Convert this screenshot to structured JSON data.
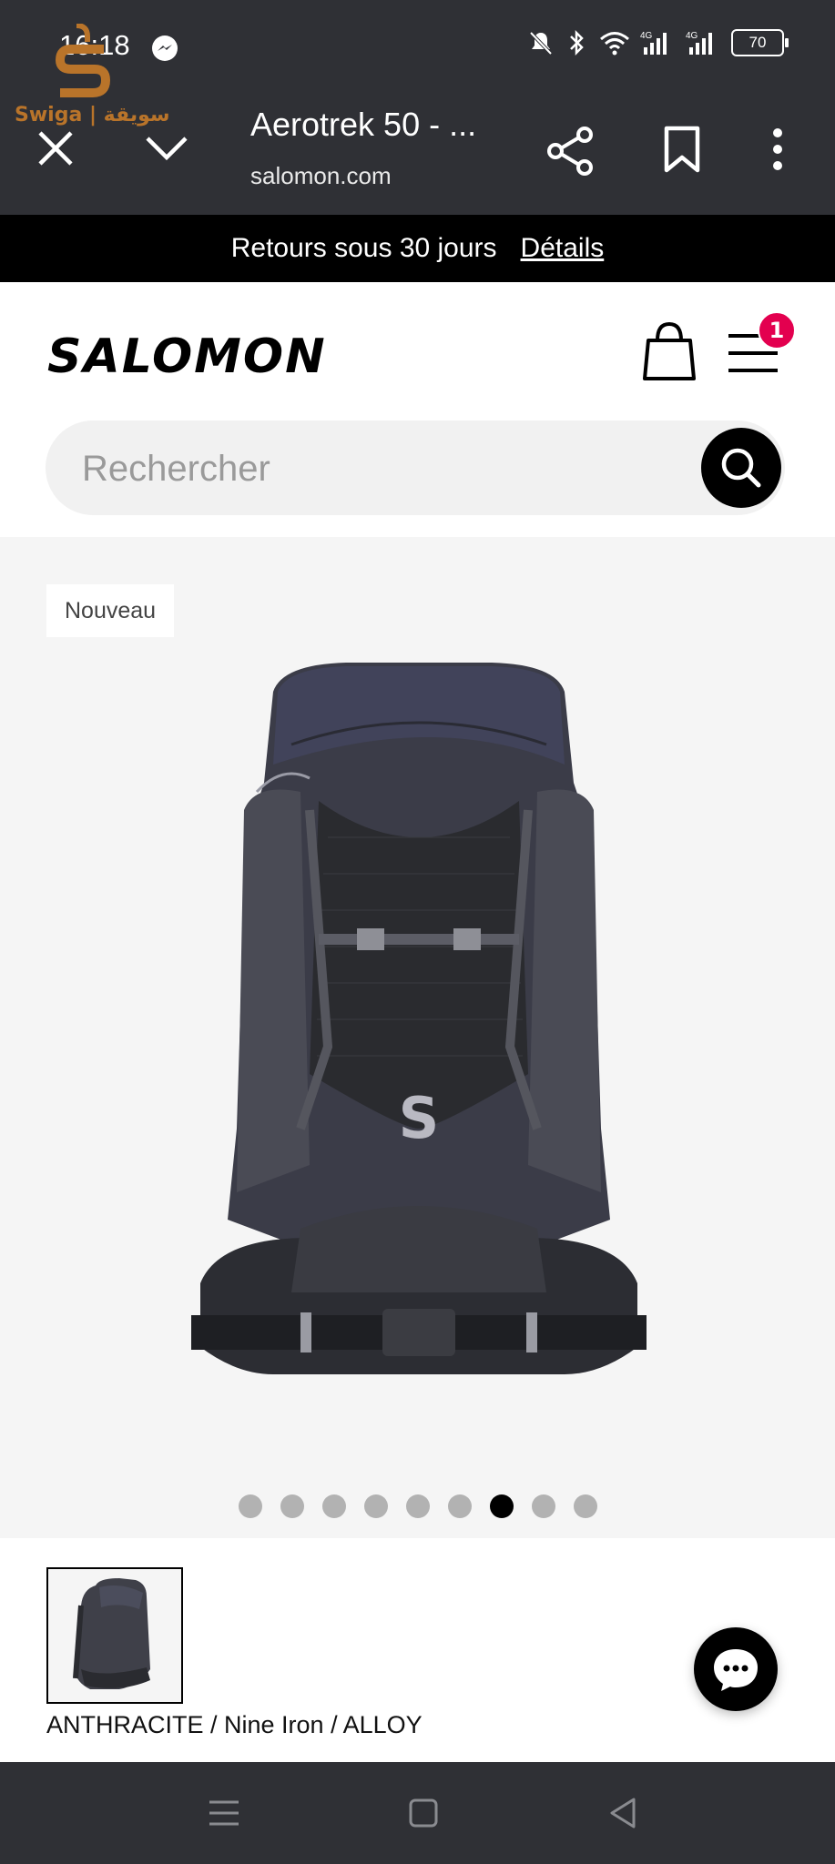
{
  "status_bar": {
    "time": "16:18",
    "battery": "70",
    "icons": [
      "messenger-icon",
      "mute-icon",
      "bluetooth-icon",
      "wifi-icon",
      "signal-4g-icon",
      "signal-4g-icon",
      "battery-icon"
    ]
  },
  "watermark": {
    "text": "Swiga | سويقة",
    "color": "#b9742a"
  },
  "browser": {
    "title": "Aerotrek 50 - ...",
    "domain": "salomon.com"
  },
  "promo": {
    "text": "Retours sous 30 jours",
    "link": "Détails"
  },
  "header": {
    "logo": "SALOMON",
    "cart_count": "1",
    "badge_color": "#e3004f"
  },
  "search": {
    "placeholder": "Rechercher"
  },
  "gallery": {
    "badge": "Nouveau",
    "slide_count": 9,
    "active_slide": 7
  },
  "variant": {
    "label": "ANTHRACITE / Nine Iron / ALLOY"
  }
}
